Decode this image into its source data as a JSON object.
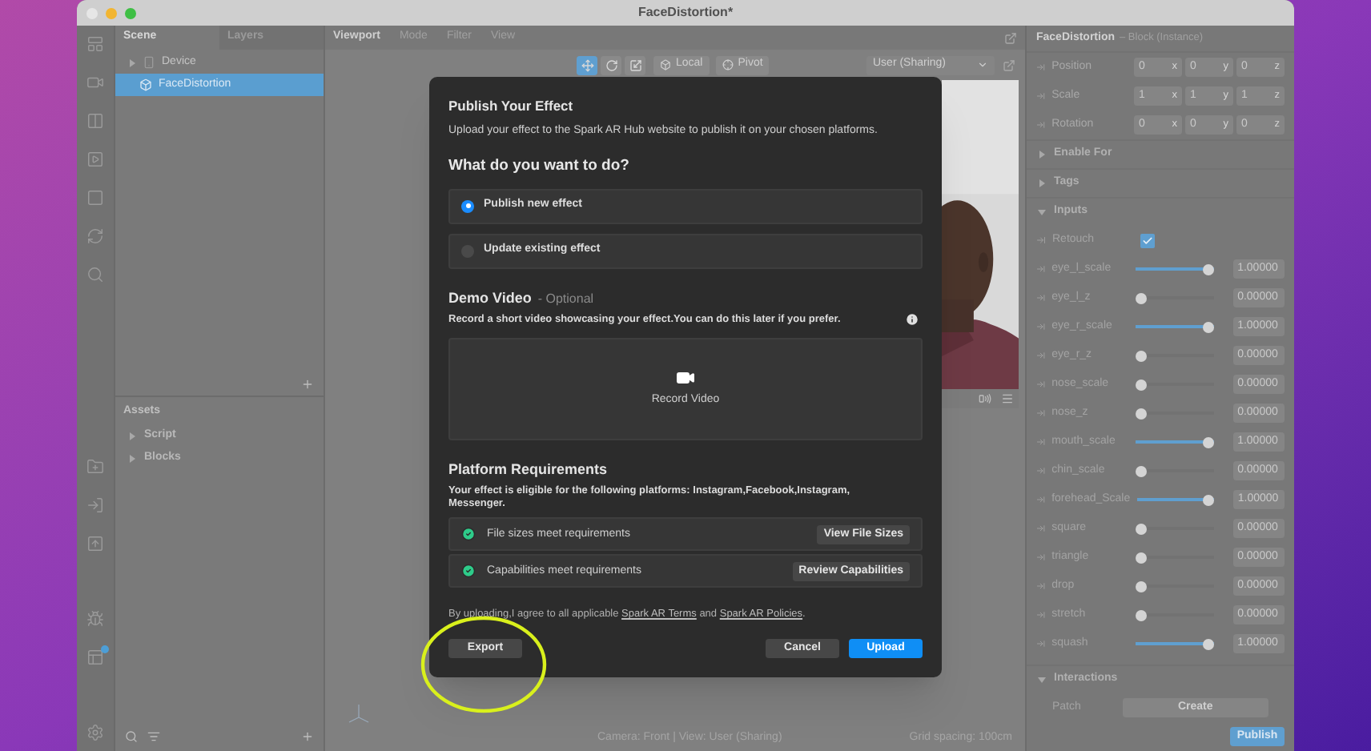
{
  "window": {
    "title": "FaceDistortion*"
  },
  "scene_panel": {
    "tabs": [
      {
        "label": "Scene",
        "selected": true
      },
      {
        "label": "Layers",
        "selected": false
      }
    ],
    "tree": [
      {
        "label": "Device",
        "kind": "device",
        "selected": false
      },
      {
        "label": "FaceDistortion",
        "kind": "block",
        "selected": true
      }
    ],
    "assets_title": "Assets",
    "assets": [
      {
        "label": "Script"
      },
      {
        "label": "Blocks"
      }
    ]
  },
  "viewport": {
    "menu": [
      "Viewport",
      "Mode",
      "Filter",
      "View"
    ],
    "tools": [
      {
        "kind": "move",
        "selected": true
      },
      {
        "kind": "rotate",
        "selected": false
      },
      {
        "kind": "scale",
        "selected": false
      }
    ],
    "space_button": "Local",
    "pivot_button": "Pivot",
    "camera_select": "User (Sharing)",
    "status": "Camera: Front | View: User (Sharing)",
    "grid": "Grid spacing: 100cm"
  },
  "dialog": {
    "title": "Publish Your Effect",
    "description": "Upload your effect to the Spark AR Hub website to publish it on your chosen platforms.",
    "question": "What do you want to do?",
    "options": [
      {
        "label": "Publish new effect",
        "selected": true
      },
      {
        "label": "Update existing effect",
        "selected": false
      }
    ],
    "demo_title": "Demo Video",
    "demo_suffix": "- Optional",
    "demo_hint": "Record a short video showcasing your effect.You can do this later if you prefer.",
    "record_label": "Record Video",
    "platform_title": "Platform Requirements",
    "platform_text": "Your effect is eligible for the following platforms: Instagram,Facebook,Instagram, Messenger.",
    "checks": [
      {
        "label": "File sizes meet requirements",
        "passed": true,
        "action": "View File Sizes"
      },
      {
        "label": "Capabilities meet requirements",
        "passed": true,
        "action": "Review Capabilities"
      }
    ],
    "terms": [
      {
        "kind": "text",
        "text": "By uploading,I agree to all applicable "
      },
      {
        "kind": "link",
        "text": "Spark AR Terms"
      },
      {
        "kind": "text",
        "text": " and "
      },
      {
        "kind": "link",
        "text": "Spark AR Policies"
      },
      {
        "kind": "text",
        "text": "."
      }
    ],
    "buttons": [
      {
        "label": "Export",
        "kind": "secondary"
      },
      {
        "label": "Cancel",
        "kind": "secondary"
      },
      {
        "label": "Upload",
        "kind": "primary"
      }
    ]
  },
  "inspector": {
    "title": "FaceDistortion",
    "subtitle": "– Block (Instance)",
    "transform": [
      {
        "label": "Position",
        "values": [
          {
            "value": "0",
            "axis": "x"
          },
          {
            "value": "0",
            "axis": "y"
          },
          {
            "value": "0",
            "axis": "z"
          }
        ]
      },
      {
        "label": "Scale",
        "values": [
          {
            "value": "1",
            "axis": "x"
          },
          {
            "value": "1",
            "axis": "y"
          },
          {
            "value": "1",
            "axis": "z"
          }
        ]
      },
      {
        "label": "Rotation",
        "values": [
          {
            "value": "0",
            "axis": "x"
          },
          {
            "value": "0",
            "axis": "y"
          },
          {
            "value": "0",
            "axis": "z"
          }
        ]
      }
    ],
    "sections": [
      {
        "label": "Enable For",
        "expanded": false
      },
      {
        "label": "Tags",
        "expanded": false
      },
      {
        "label": "Inputs",
        "expanded": true
      }
    ],
    "inputs": [
      {
        "kind": "checkbox",
        "label": "Retouch",
        "checked": true
      },
      {
        "kind": "slider",
        "label": "eye_l_scale",
        "level": 1,
        "reading": "1.00000"
      },
      {
        "kind": "slider",
        "label": "eye_l_z",
        "level": 0,
        "reading": "0.00000"
      },
      {
        "kind": "slider",
        "label": "eye_r_scale",
        "level": 1,
        "reading": "1.00000"
      },
      {
        "kind": "slider",
        "label": "eye_r_z",
        "level": 0,
        "reading": "0.00000"
      },
      {
        "kind": "slider",
        "label": "nose_scale",
        "level": 0,
        "reading": "0.00000"
      },
      {
        "kind": "slider",
        "label": "nose_z",
        "level": 0,
        "reading": "0.00000"
      },
      {
        "kind": "slider",
        "label": "mouth_scale",
        "level": 1,
        "reading": "1.00000"
      },
      {
        "kind": "slider",
        "label": "chin_scale",
        "level": 0,
        "reading": "0.00000"
      },
      {
        "kind": "slider",
        "label": "forehead_Scale",
        "level": 1,
        "reading": "1.00000"
      },
      {
        "kind": "slider",
        "label": "square",
        "level": 0,
        "reading": "0.00000"
      },
      {
        "kind": "slider",
        "label": "triangle",
        "level": 0,
        "reading": "0.00000"
      },
      {
        "kind": "slider",
        "label": "drop",
        "level": 0,
        "reading": "0.00000"
      },
      {
        "kind": "slider",
        "label": "stretch",
        "level": 0,
        "reading": "0.00000"
      },
      {
        "kind": "slider",
        "label": "squash",
        "level": 1,
        "reading": "1.00000"
      }
    ],
    "interactions": {
      "label": "Interactions",
      "expanded": true,
      "patch_label": "Patch",
      "create_button": "Create"
    },
    "publish_button": "Publish"
  }
}
